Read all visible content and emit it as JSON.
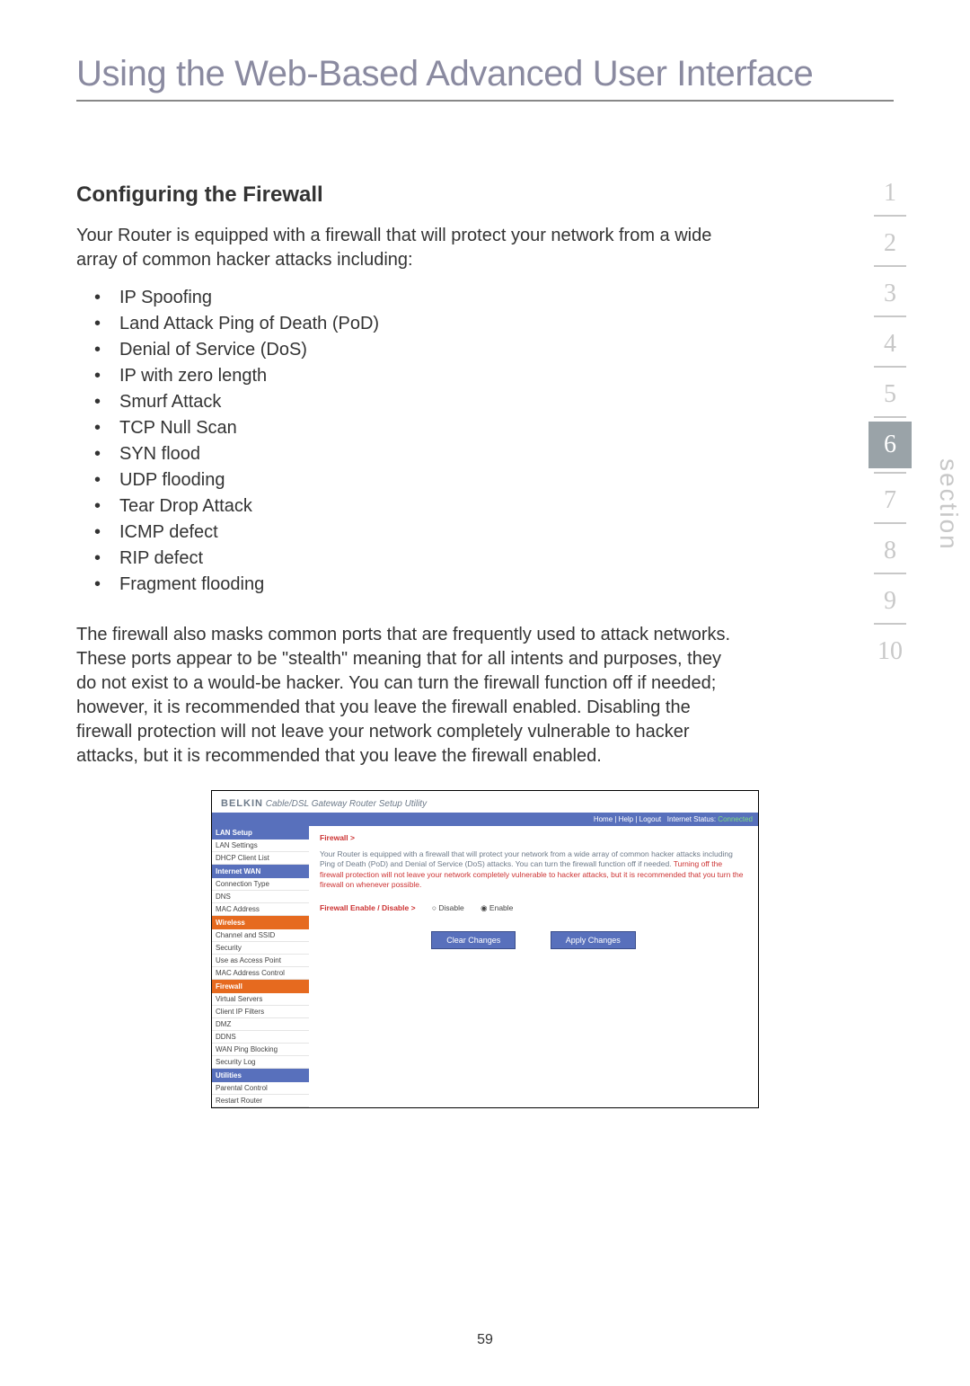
{
  "page": {
    "title": "Using the Web-Based Advanced User Interface",
    "pageNumber": "59"
  },
  "firewall": {
    "heading": "Configuring the Firewall",
    "intro": "Your Router is equipped with a firewall that will protect your network from a wide array of common hacker attacks including:",
    "attacks": [
      "IP Spoofing",
      "Land Attack Ping of Death (PoD)",
      "Denial of Service (DoS)",
      "IP with zero length",
      "Smurf Attack",
      "TCP Null Scan",
      "SYN flood",
      "UDP flooding",
      "Tear Drop Attack",
      "ICMP defect",
      "RIP defect",
      "Fragment flooding"
    ],
    "description": "The firewall also masks common ports that are frequently used to attack networks. These ports appear to be \"stealth\" meaning that for all intents and purposes, they do not exist to a would-be hacker. You can turn the firewall function off if needed; however, it is recommended that you leave the firewall enabled. Disabling the firewall protection will not leave your network completely vulnerable to hacker attacks, but it is recommended that you leave the firewall enabled."
  },
  "sectionNav": {
    "items": [
      "1",
      "2",
      "3",
      "4",
      "5",
      "6",
      "7",
      "8",
      "9",
      "10"
    ],
    "current": "6",
    "label": "section"
  },
  "routerUI": {
    "brand": "BELKIN",
    "brandSuffix": " Cable/DSL Gateway Router Setup Utility",
    "topbarLinks": "Home | Help | Logout",
    "statusLabel": "Internet Status:",
    "statusValue": "Connected",
    "sidebar": {
      "groups": [
        {
          "header": "LAN Setup",
          "items": [
            "LAN Settings",
            "DHCP Client List"
          ]
        },
        {
          "header": "Internet WAN",
          "items": [
            "Connection Type",
            "DNS",
            "MAC Address"
          ]
        },
        {
          "header": "Wireless",
          "color": "orange",
          "items": [
            "Channel and SSID",
            "Security",
            "Use as Access Point",
            "MAC Address Control"
          ]
        },
        {
          "header": "Firewall",
          "color": "orange",
          "items": [
            "Virtual Servers",
            "Client IP Filters",
            "DMZ",
            "DDNS",
            "WAN Ping Blocking",
            "Security Log"
          ]
        },
        {
          "header": "Utilities",
          "items": [
            "Parental Control",
            "Restart Router"
          ]
        }
      ]
    },
    "content": {
      "title": "Firewall >",
      "desc1": "Your Router is equipped with a firewall that will protect your network from a wide array of common hacker attacks including Ping of Death (PoD) and Denial of Service (DoS) attacks. You can turn the firewall function off if needed. ",
      "desc2red": "Turning off the firewall protection will not leave your network completely vulnerable to hacker attacks, but it is recommended that you turn the firewall on whenever possible.",
      "toggleLabel": "Firewall Enable / Disable >",
      "optDisable": "Disable",
      "optEnable": "Enable",
      "clearBtn": "Clear Changes",
      "applyBtn": "Apply Changes"
    }
  }
}
